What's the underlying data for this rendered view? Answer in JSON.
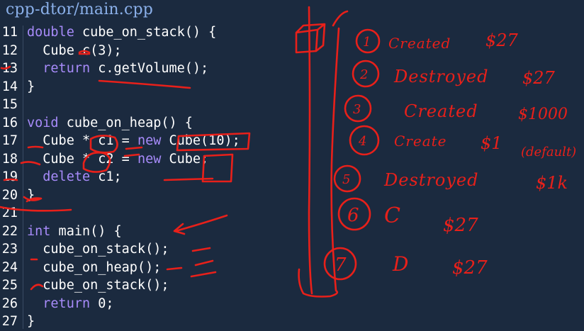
{
  "file_title": "cpp-dtor/main.cpp",
  "code_lines": [
    {
      "num": "11",
      "parts": [
        {
          "t": "double",
          "c": "kw"
        },
        {
          "t": " cube_on_stack() {",
          "c": "fn"
        }
      ]
    },
    {
      "num": "12",
      "parts": [
        {
          "t": "  Cube c(3);",
          "c": "fn"
        }
      ]
    },
    {
      "num": "13",
      "parts": [
        {
          "t": "  ",
          "c": "fn"
        },
        {
          "t": "return",
          "c": "kw"
        },
        {
          "t": " c.getVolume();",
          "c": "fn"
        }
      ]
    },
    {
      "num": "14",
      "parts": [
        {
          "t": "}",
          "c": "fn"
        }
      ]
    },
    {
      "num": "15",
      "parts": []
    },
    {
      "num": "16",
      "parts": [
        {
          "t": "void",
          "c": "kw"
        },
        {
          "t": " cube_on_heap() {",
          "c": "fn"
        }
      ]
    },
    {
      "num": "17",
      "parts": [
        {
          "t": "  Cube * c1 = ",
          "c": "fn"
        },
        {
          "t": "new",
          "c": "kw"
        },
        {
          "t": " Cube(10);",
          "c": "fn"
        }
      ]
    },
    {
      "num": "18",
      "parts": [
        {
          "t": "  Cube * c2 = ",
          "c": "fn"
        },
        {
          "t": "new",
          "c": "kw"
        },
        {
          "t": " Cube;",
          "c": "fn"
        }
      ]
    },
    {
      "num": "19",
      "parts": [
        {
          "t": "  ",
          "c": "fn"
        },
        {
          "t": "delete",
          "c": "kw"
        },
        {
          "t": " c1;",
          "c": "fn"
        }
      ]
    },
    {
      "num": "20",
      "parts": [
        {
          "t": "}",
          "c": "fn"
        }
      ]
    },
    {
      "num": "21",
      "parts": []
    },
    {
      "num": "22",
      "parts": [
        {
          "t": "int",
          "c": "kw"
        },
        {
          "t": " main() {",
          "c": "fn"
        }
      ]
    },
    {
      "num": "23",
      "parts": [
        {
          "t": "  cube_on_stack();",
          "c": "fn"
        }
      ]
    },
    {
      "num": "24",
      "parts": [
        {
          "t": "  cube_on_heap();",
          "c": "fn"
        }
      ]
    },
    {
      "num": "25",
      "parts": [
        {
          "t": "  cube_on_stack();",
          "c": "fn"
        }
      ]
    },
    {
      "num": "26",
      "parts": [
        {
          "t": "  ",
          "c": "fn"
        },
        {
          "t": "return",
          "c": "kw"
        },
        {
          "t": " 0;",
          "c": "fn"
        }
      ]
    },
    {
      "num": "27",
      "parts": [
        {
          "t": "}",
          "c": "fn"
        }
      ]
    }
  ],
  "annotations": {
    "items": [
      {
        "num": "1",
        "event": "Created",
        "value": "$27"
      },
      {
        "num": "2",
        "event": "Destroyed",
        "value": "$27"
      },
      {
        "num": "3",
        "event": "Created",
        "value": "$1000"
      },
      {
        "num": "4",
        "event": "Create",
        "value": "$1"
      },
      {
        "num": "5",
        "event": "Destroyed",
        "value": "$1k"
      },
      {
        "num": "6",
        "event": "C",
        "value": "$27"
      },
      {
        "num": "7",
        "event": "D",
        "value": "$27"
      }
    ],
    "side_note": "(default)",
    "ink_color": "#e8201a"
  },
  "colors": {
    "background": "#1b2a3f",
    "keyword": "#a78bfa",
    "text": "#ffffff",
    "title": "#8ab0ea"
  }
}
